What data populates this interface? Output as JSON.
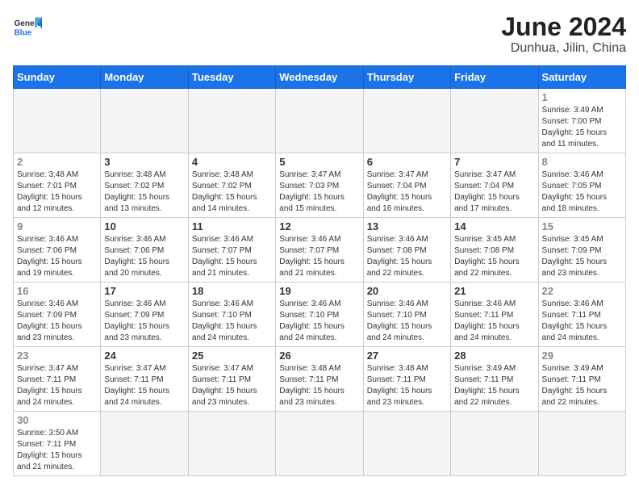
{
  "header": {
    "logo": {
      "general": "General",
      "blue": "Blue"
    },
    "title": "June 2024",
    "subtitle": "Dunhua, Jilin, China"
  },
  "weekdays": [
    "Sunday",
    "Monday",
    "Tuesday",
    "Wednesday",
    "Thursday",
    "Friday",
    "Saturday"
  ],
  "weeks": [
    [
      {
        "day": "",
        "info": ""
      },
      {
        "day": "",
        "info": ""
      },
      {
        "day": "",
        "info": ""
      },
      {
        "day": "",
        "info": ""
      },
      {
        "day": "",
        "info": ""
      },
      {
        "day": "",
        "info": ""
      },
      {
        "day": "1",
        "info": "Sunrise: 3:49 AM\nSunset: 7:00 PM\nDaylight: 15 hours\nand 11 minutes."
      }
    ],
    [
      {
        "day": "2",
        "info": "Sunrise: 3:48 AM\nSunset: 7:01 PM\nDaylight: 15 hours\nand 12 minutes."
      },
      {
        "day": "3",
        "info": "Sunrise: 3:48 AM\nSunset: 7:02 PM\nDaylight: 15 hours\nand 13 minutes."
      },
      {
        "day": "4",
        "info": "Sunrise: 3:48 AM\nSunset: 7:02 PM\nDaylight: 15 hours\nand 14 minutes."
      },
      {
        "day": "5",
        "info": "Sunrise: 3:47 AM\nSunset: 7:03 PM\nDaylight: 15 hours\nand 15 minutes."
      },
      {
        "day": "6",
        "info": "Sunrise: 3:47 AM\nSunset: 7:04 PM\nDaylight: 15 hours\nand 16 minutes."
      },
      {
        "day": "7",
        "info": "Sunrise: 3:47 AM\nSunset: 7:04 PM\nDaylight: 15 hours\nand 17 minutes."
      },
      {
        "day": "8",
        "info": "Sunrise: 3:46 AM\nSunset: 7:05 PM\nDaylight: 15 hours\nand 18 minutes."
      }
    ],
    [
      {
        "day": "9",
        "info": "Sunrise: 3:46 AM\nSunset: 7:06 PM\nDaylight: 15 hours\nand 19 minutes."
      },
      {
        "day": "10",
        "info": "Sunrise: 3:46 AM\nSunset: 7:06 PM\nDaylight: 15 hours\nand 20 minutes."
      },
      {
        "day": "11",
        "info": "Sunrise: 3:46 AM\nSunset: 7:07 PM\nDaylight: 15 hours\nand 21 minutes."
      },
      {
        "day": "12",
        "info": "Sunrise: 3:46 AM\nSunset: 7:07 PM\nDaylight: 15 hours\nand 21 minutes."
      },
      {
        "day": "13",
        "info": "Sunrise: 3:46 AM\nSunset: 7:08 PM\nDaylight: 15 hours\nand 22 minutes."
      },
      {
        "day": "14",
        "info": "Sunrise: 3:45 AM\nSunset: 7:08 PM\nDaylight: 15 hours\nand 22 minutes."
      },
      {
        "day": "15",
        "info": "Sunrise: 3:45 AM\nSunset: 7:09 PM\nDaylight: 15 hours\nand 23 minutes."
      }
    ],
    [
      {
        "day": "16",
        "info": "Sunrise: 3:46 AM\nSunset: 7:09 PM\nDaylight: 15 hours\nand 23 minutes."
      },
      {
        "day": "17",
        "info": "Sunrise: 3:46 AM\nSunset: 7:09 PM\nDaylight: 15 hours\nand 23 minutes."
      },
      {
        "day": "18",
        "info": "Sunrise: 3:46 AM\nSunset: 7:10 PM\nDaylight: 15 hours\nand 24 minutes."
      },
      {
        "day": "19",
        "info": "Sunrise: 3:46 AM\nSunset: 7:10 PM\nDaylight: 15 hours\nand 24 minutes."
      },
      {
        "day": "20",
        "info": "Sunrise: 3:46 AM\nSunset: 7:10 PM\nDaylight: 15 hours\nand 24 minutes."
      },
      {
        "day": "21",
        "info": "Sunrise: 3:46 AM\nSunset: 7:11 PM\nDaylight: 15 hours\nand 24 minutes."
      },
      {
        "day": "22",
        "info": "Sunrise: 3:46 AM\nSunset: 7:11 PM\nDaylight: 15 hours\nand 24 minutes."
      }
    ],
    [
      {
        "day": "23",
        "info": "Sunrise: 3:47 AM\nSunset: 7:11 PM\nDaylight: 15 hours\nand 24 minutes."
      },
      {
        "day": "24",
        "info": "Sunrise: 3:47 AM\nSunset: 7:11 PM\nDaylight: 15 hours\nand 24 minutes."
      },
      {
        "day": "25",
        "info": "Sunrise: 3:47 AM\nSunset: 7:11 PM\nDaylight: 15 hours\nand 23 minutes."
      },
      {
        "day": "26",
        "info": "Sunrise: 3:48 AM\nSunset: 7:11 PM\nDaylight: 15 hours\nand 23 minutes."
      },
      {
        "day": "27",
        "info": "Sunrise: 3:48 AM\nSunset: 7:11 PM\nDaylight: 15 hours\nand 23 minutes."
      },
      {
        "day": "28",
        "info": "Sunrise: 3:49 AM\nSunset: 7:11 PM\nDaylight: 15 hours\nand 22 minutes."
      },
      {
        "day": "29",
        "info": "Sunrise: 3:49 AM\nSunset: 7:11 PM\nDaylight: 15 hours\nand 22 minutes."
      }
    ],
    [
      {
        "day": "30",
        "info": "Sunrise: 3:50 AM\nSunset: 7:11 PM\nDaylight: 15 hours\nand 21 minutes."
      },
      {
        "day": "",
        "info": ""
      },
      {
        "day": "",
        "info": ""
      },
      {
        "day": "",
        "info": ""
      },
      {
        "day": "",
        "info": ""
      },
      {
        "day": "",
        "info": ""
      },
      {
        "day": "",
        "info": ""
      }
    ]
  ]
}
